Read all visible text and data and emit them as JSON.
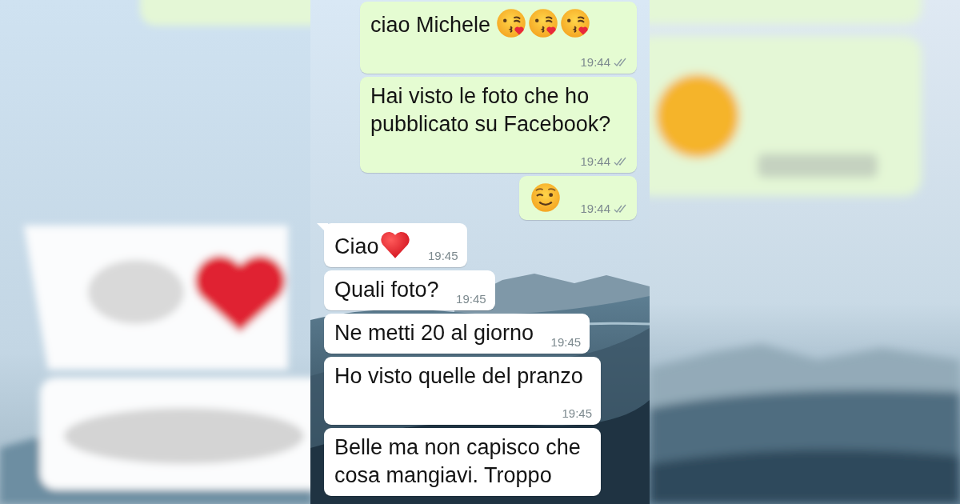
{
  "messages": [
    {
      "kind": "outgoing",
      "text": "ciao Michele",
      "icons": [
        {
          "kind": "kiss"
        },
        {
          "kind": "kiss"
        },
        {
          "kind": "kiss"
        }
      ],
      "time": "19:44",
      "read": false
    },
    {
      "kind": "outgoing",
      "text": "Hai visto le foto che ho pubblicato su Facebook?",
      "time": "19:44",
      "read": false
    },
    {
      "kind": "outgoing",
      "icons": [
        {
          "kind": "wink"
        }
      ],
      "time": "19:44",
      "read": false
    },
    {
      "kind": "incoming",
      "text": "Ciao",
      "icons": [
        {
          "kind": "heart"
        }
      ],
      "time": "19:45",
      "tail": true
    },
    {
      "kind": "incoming",
      "text": "Quali foto?",
      "time": "19:45"
    },
    {
      "kind": "incoming",
      "text": "Ne metti 20 al giorno",
      "time": "19:45"
    },
    {
      "kind": "incoming",
      "text": "Ho visto quelle del pranzo",
      "time": "19:45"
    },
    {
      "kind": "incoming",
      "text": "Belle ma non capisco che cosa mangiavi. Troppo"
    }
  ]
}
